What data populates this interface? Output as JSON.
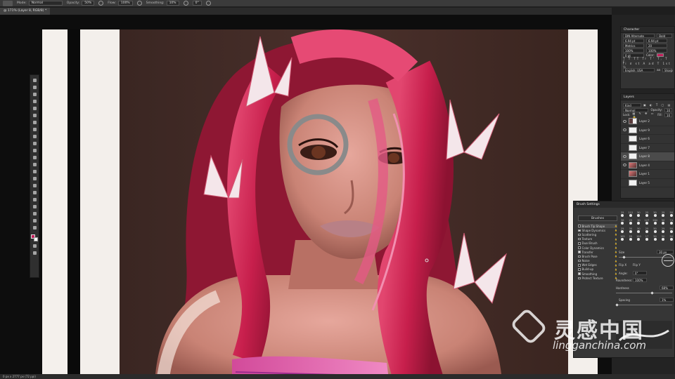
{
  "options_bar": {
    "mode_label": "Mode:",
    "mode_value": "Normal",
    "opacity_label": "Opacity:",
    "opacity_value": "50%",
    "flow_label": "Flow:",
    "flow_value": "100%",
    "smoothing_label": "Smoothing:",
    "smoothing_value": "10%",
    "angle_value": "0°"
  },
  "document": {
    "tab_label": "@ 171% (Layer 8, RGB/8) *"
  },
  "status_bar": {
    "text": "0 px x 2777 px (72 ppi)"
  },
  "character_panel": {
    "title": "Character",
    "font_family": "DIN Alternate",
    "font_style": "Bold",
    "font_size": "6.94 pt",
    "leading": "6.94 pt",
    "kerning": "Metrics",
    "tracking": "20",
    "vscale": "100%",
    "hscale": "100%",
    "baseline": "0 pt",
    "color_label": "Color:",
    "language": "English: USA",
    "aa": "Sharp"
  },
  "layers_panel": {
    "title": "Layers",
    "filter": "Kind",
    "blend_mode": "Normal",
    "opacity_label": "Opacity:",
    "opacity_value": "10",
    "lock_label": "Lock:",
    "fill_label": "Fill:",
    "fill_value": "10",
    "layers": [
      {
        "name": "Layer 2",
        "visible": true,
        "thumb": "dark"
      },
      {
        "name": "Layer 9",
        "visible": true,
        "thumb": "white"
      },
      {
        "name": "Layer 6",
        "visible": false,
        "thumb": "white"
      },
      {
        "name": "Layer 7",
        "visible": false,
        "thumb": "white"
      },
      {
        "name": "Layer 8",
        "visible": true,
        "thumb": "white",
        "selected": true
      },
      {
        "name": "Layer 4",
        "visible": true,
        "thumb": "pic"
      },
      {
        "name": "Layer 1",
        "visible": false,
        "thumb": "pic"
      },
      {
        "name": "Layer 5",
        "visible": false,
        "thumb": "white"
      }
    ]
  },
  "brush_settings": {
    "title": "Brush Settings",
    "brushes_button": "Brushes",
    "options": [
      {
        "label": "Brush Tip Shape",
        "checked": false,
        "selected": true
      },
      {
        "label": "Shape Dynamics",
        "checked": true
      },
      {
        "label": "Scattering",
        "checked": false
      },
      {
        "label": "Texture",
        "checked": false
      },
      {
        "label": "Dual Brush",
        "checked": false
      },
      {
        "label": "Color Dynamics",
        "checked": false
      },
      {
        "label": "Transfer",
        "checked": true
      },
      {
        "label": "Brush Pose",
        "checked": false
      },
      {
        "label": "Noise",
        "checked": false
      },
      {
        "label": "Wet Edges",
        "checked": false
      },
      {
        "label": "Build-up",
        "checked": false
      },
      {
        "label": "Smoothing",
        "checked": true
      },
      {
        "label": "Protect Texture",
        "checked": false
      }
    ],
    "tip_sizes": [
      "25",
      "112",
      "50",
      "25",
      "50",
      "25",
      "50",
      "36",
      "25",
      "30",
      "127",
      "264",
      "50",
      "74",
      "25",
      "30",
      "50",
      "25",
      "50",
      "25",
      "50",
      "105",
      "25",
      "150",
      "17",
      "50",
      "50",
      "50"
    ],
    "size_label": "Size",
    "size_value": "30 px",
    "flip_x": "Flip X",
    "flip_y": "Flip Y",
    "angle_label": "Angle:",
    "angle_value": "0°",
    "roundness_label": "Roundness:",
    "roundness_value": "100%",
    "hardness_label": "Hardness",
    "hardness_value": "68%",
    "spacing_label": "Spacing",
    "spacing_value": "1%"
  },
  "watermark": {
    "cn": "灵感中国",
    "en": "lingganchina.com"
  }
}
